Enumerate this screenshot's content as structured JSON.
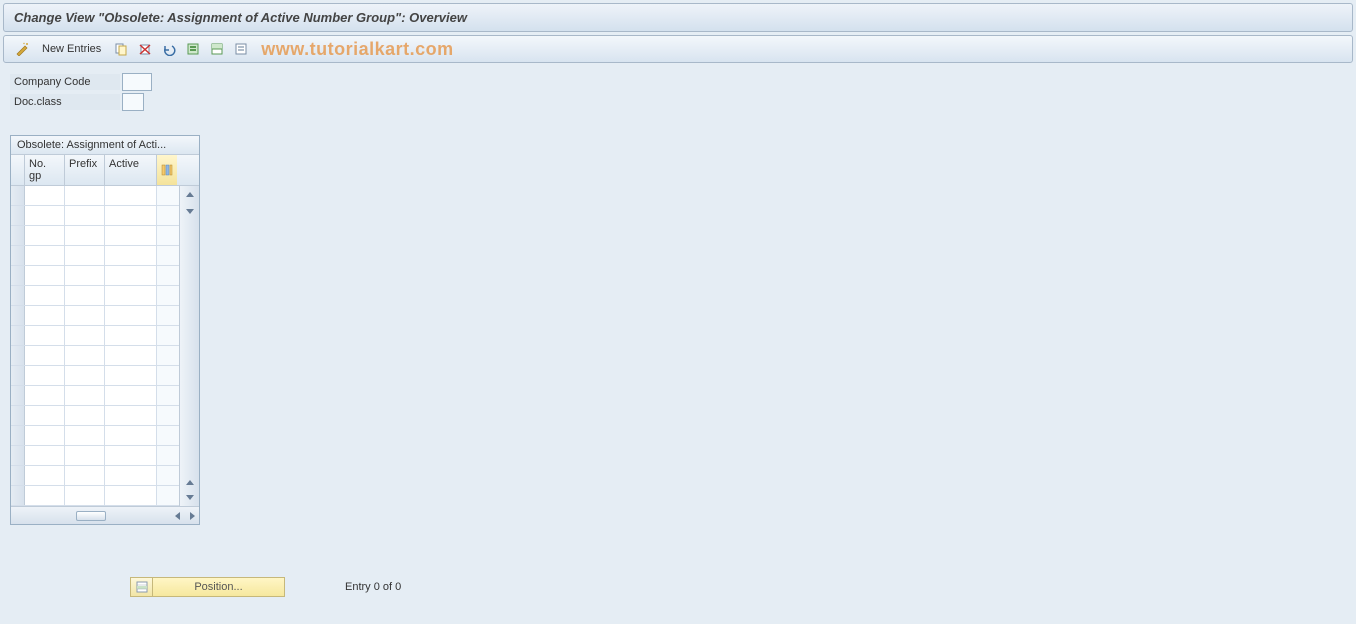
{
  "header": {
    "title": "Change View \"Obsolete: Assignment of Active Number Group\": Overview"
  },
  "toolbar": {
    "new_entries_label": "New Entries",
    "icons": {
      "wand": "wand-icon",
      "copy": "copy-icon",
      "delete": "delete-icon",
      "undo": "undo-icon",
      "select_all": "select-all-icon",
      "select_block": "select-block-icon",
      "deselect": "deselect-icon"
    }
  },
  "watermark": "www.tutorialkart.com",
  "form": {
    "company_code_label": "Company Code",
    "company_code_value": "",
    "doc_class_label": "Doc.class",
    "doc_class_value": ""
  },
  "table": {
    "title": "Obsolete: Assignment of Acti...",
    "columns": {
      "no_gp": "No. gp",
      "prefix": "Prefix",
      "active": "Active"
    },
    "row_count": 16
  },
  "footer": {
    "position_label": "Position...",
    "entry_text": "Entry 0 of 0"
  }
}
